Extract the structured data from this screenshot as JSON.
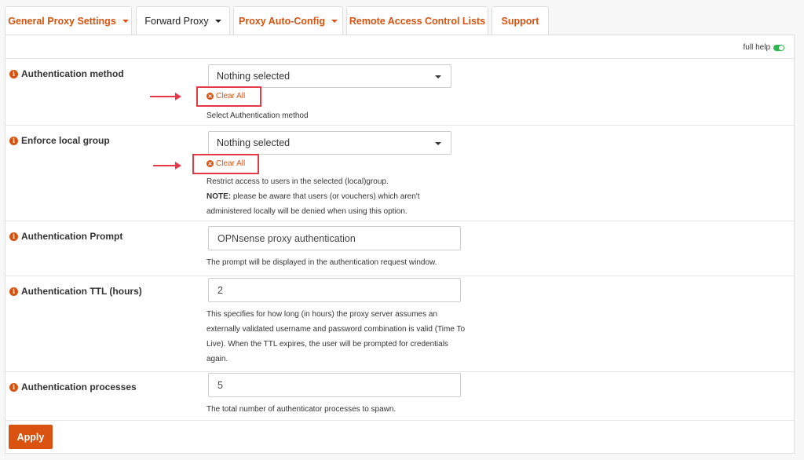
{
  "tabs": [
    {
      "label": "General Proxy Settings",
      "dropdown": true
    },
    {
      "label": "Forward Proxy",
      "dropdown": true,
      "active": true
    },
    {
      "label": "Proxy Auto-Config",
      "dropdown": true
    },
    {
      "label": "Remote Access Control Lists",
      "dropdown": false
    },
    {
      "label": "Support",
      "dropdown": false
    }
  ],
  "help_toggle": {
    "label": "full help",
    "state": "on"
  },
  "fields": {
    "auth_method": {
      "label": "Authentication method",
      "value": "Nothing selected",
      "clear": "Clear All",
      "help": "Select Authentication method"
    },
    "local_group": {
      "label": "Enforce local group",
      "value": "Nothing selected",
      "clear": "Clear All",
      "help_line1": "Restrict access to users in the selected (local)group.",
      "note_label": "NOTE:",
      "note_text": " please be aware that users (or vouchers) which aren't",
      "help_line3": "administered locally will be denied when using this option."
    },
    "auth_prompt": {
      "label": "Authentication Prompt",
      "value": "OPNsense proxy authentication",
      "help": "The prompt will be displayed in the authentication request window."
    },
    "auth_ttl": {
      "label": "Authentication TTL (hours)",
      "value": "2",
      "help": "This specifies for how long (in hours) the proxy server assumes an externally validated username and password combination is valid (Time To Live). When the TTL expires, the user will be prompted for credentials again."
    },
    "auth_processes": {
      "label": "Authentication processes",
      "value": "5",
      "help": "The total number of authenticator processes to spawn."
    }
  },
  "apply_label": "Apply",
  "colors": {
    "accent": "#d9520f",
    "annotation": "#e53948",
    "toggle": "#2db84d"
  }
}
